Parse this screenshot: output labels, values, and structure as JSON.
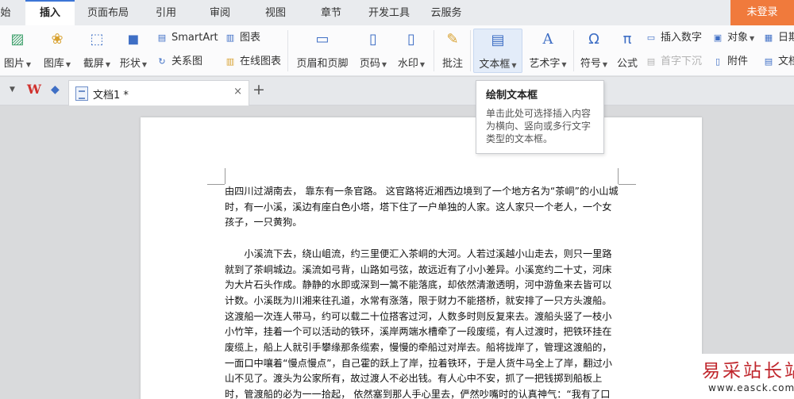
{
  "menu": {
    "tabs": [
      "始",
      "插入",
      "页面布局",
      "引用",
      "审阅",
      "视图",
      "章节",
      "开发工具",
      "云服务"
    ],
    "active": "插入",
    "login": "未登录"
  },
  "ribbon": {
    "picture": "图片",
    "gallery": "图库",
    "screenshot": "截屏",
    "shapes": "形状",
    "smartart": "SmartArt",
    "relation": "关系图",
    "chart": "图表",
    "online_chart": "在线图表",
    "header_footer": "页眉和页脚",
    "page_number": "页码",
    "watermark": "水印",
    "comment": "批注",
    "textbox": "文本框",
    "wordart": "艺术字",
    "symbol": "符号",
    "formula": "公式",
    "insert_number": "插入数字",
    "object": "对象",
    "date": "日期",
    "drop_cap": "首字下沉",
    "attachment": "附件",
    "doc_parts": "文档"
  },
  "doc_tab": {
    "name": "文档1 *",
    "close": "×",
    "new": "+"
  },
  "tooltip": {
    "title": "绘制文本框",
    "body": "单击此处可选择插入内容为横向、竖向或多行文字类型的文本框。"
  },
  "document": {
    "para1": "由四川过湖南去， 靠东有一条官路。 这官路将近湘西边境到了一个地方名为“茶峒”的小山城时，有一小溪，溪边有座白色小塔，塔下住了一户单独的人家。这人家只一个老人，一个女孩子，一只黄狗。",
    "para2": "小溪流下去，绕山岨流，约三里便汇入茶峒的大河。人若过溪越小山走去，则只一里路就到了茶峒城边。溪流如弓背，山路如弓弦，故远近有了小小差异。小溪宽约二十丈，河床为大片石头作成。静静的水即或深到一篙不能落底，却依然清澈透明，河中游鱼来去皆可以计数。小溪既为川湘来往孔道，水常有涨落，限于财力不能搭桥，就安排了一只方头渡船。这渡船一次连人带马，约可以载二十位搭客过河，人数多时则反复来去。渡船头竖了一枝小小竹竿，挂着一个可以活动的铁环，溪岸两端水槽牵了一段废缆，有人过渡时，把铁环挂在废缆上，船上人就引手攀缘那条缆索，慢慢的牵船过对岸去。船将拢岸了，管理这渡船的，一面口中嚷着“慢点慢点”，自己霍的跃上了岸，拉着铁环，于是人货牛马全上了岸，翻过小山不见了。渡头为公家所有，故过渡人不必出钱。有人心中不安，抓了一把钱掷到船板上时，管渡船的必为一一拾起， 依然塞到那人手心里去，俨然吵嘴时的认真神气：“我有了口量，三斗米，七百钱，够了。谁要这个！”"
  },
  "watermark": {
    "cn": "易采站长站",
    "en": "www.easck.com"
  }
}
